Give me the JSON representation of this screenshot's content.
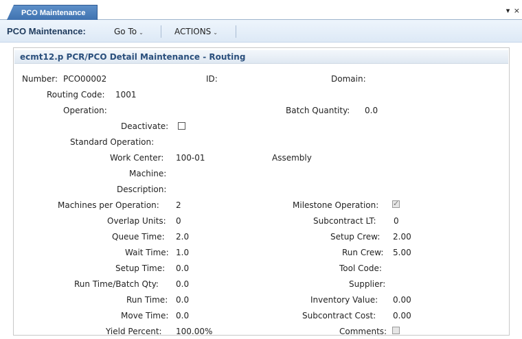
{
  "tab": {
    "label": "PCO Maintenance",
    "controls": "▾ ×"
  },
  "toolbar": {
    "title": "PCO Maintenance:",
    "goto_label": "Go To",
    "actions_label": "ACTIONS"
  },
  "panel": {
    "title": "ecmt12.p  PCR/PCO Detail Maintenance - Routing"
  },
  "fields": {
    "number": {
      "label": "Number:",
      "value": "PCO00002"
    },
    "id": {
      "label": "ID:",
      "value": ""
    },
    "domain": {
      "label": "Domain:",
      "value": ""
    },
    "routing_code": {
      "label": "Routing Code:",
      "value": "1001"
    },
    "operation": {
      "label": "Operation:",
      "value": ""
    },
    "batch_quantity": {
      "label": "Batch Quantity:",
      "value": "0.0"
    },
    "deactivate": {
      "label": "Deactivate:",
      "checked": false
    },
    "standard_operation": {
      "label": "Standard Operation:",
      "value": ""
    },
    "work_center": {
      "label": "Work Center:",
      "value": "100-01",
      "description": "Assembly"
    },
    "machine": {
      "label": "Machine:",
      "value": ""
    },
    "description": {
      "label": "Description:",
      "value": ""
    },
    "machines_per_operation": {
      "label": "Machines per Operation:",
      "value": "2"
    },
    "milestone_operation": {
      "label": "Milestone Operation:",
      "checked": true
    },
    "overlap_units": {
      "label": "Overlap Units:",
      "value": "0"
    },
    "subcontract_lt": {
      "label": "Subcontract LT:",
      "value": "0"
    },
    "queue_time": {
      "label": "Queue Time:",
      "value": "2.0"
    },
    "setup_crew": {
      "label": "Setup Crew:",
      "value": "2.00"
    },
    "wait_time": {
      "label": "Wait Time:",
      "value": "1.0"
    },
    "run_crew": {
      "label": "Run Crew:",
      "value": "5.00"
    },
    "setup_time": {
      "label": "Setup Time:",
      "value": "0.0"
    },
    "tool_code": {
      "label": "Tool Code:",
      "value": ""
    },
    "run_time_batch_qty": {
      "label": "Run Time/Batch Qty:",
      "value": "0.0"
    },
    "supplier": {
      "label": "Supplier:",
      "value": ""
    },
    "run_time": {
      "label": "Run Time:",
      "value": "0.0"
    },
    "inventory_value": {
      "label": "Inventory Value:",
      "value": "0.00"
    },
    "move_time": {
      "label": "Move Time:",
      "value": "0.0"
    },
    "subcontract_cost": {
      "label": "Subcontract Cost:",
      "value": "0.00"
    },
    "yield_percent": {
      "label": "Yield Percent:",
      "value": "100.00%"
    },
    "comments": {
      "label": "Comments:",
      "checked": false
    }
  },
  "colors": {
    "tab": "#4a7fbf",
    "toolbar": "#e4eef8",
    "title": "#2a4f7c"
  }
}
